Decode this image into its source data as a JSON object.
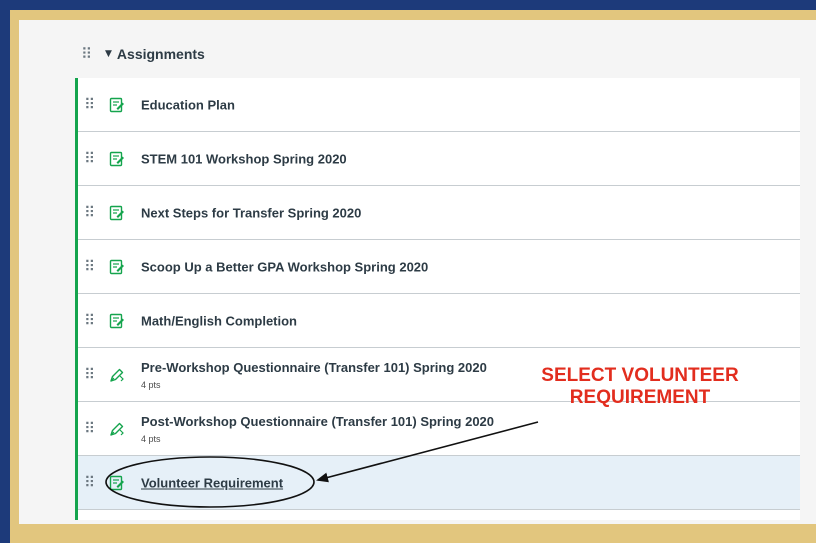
{
  "group": {
    "title": "Assignments",
    "handle_glyph": "⠿",
    "caret_glyph": "▼"
  },
  "items": [
    {
      "title": "Education Plan",
      "icon": "assignment-icon",
      "pts": ""
    },
    {
      "title": "STEM 101 Workshop Spring 2020",
      "icon": "assignment-icon",
      "pts": ""
    },
    {
      "title": "Next Steps for Transfer Spring 2020",
      "icon": "assignment-icon",
      "pts": ""
    },
    {
      "title": "Scoop Up a Better GPA Workshop Spring 2020",
      "icon": "assignment-icon",
      "pts": ""
    },
    {
      "title": "Math/English Completion",
      "icon": "assignment-icon",
      "pts": ""
    },
    {
      "title": "Pre-Workshop Questionnaire (Transfer 101) Spring 2020",
      "icon": "quiz-icon",
      "pts": "4 pts"
    },
    {
      "title": "Post-Workshop Questionnaire (Transfer 101) Spring 2020",
      "icon": "quiz-icon",
      "pts": "4 pts"
    },
    {
      "title": "Volunteer Requirement",
      "icon": "assignment-icon",
      "pts": ""
    }
  ],
  "callout": {
    "line1": "SELECT VOLUNTEER",
    "line2": "REQUIREMENT"
  },
  "colors": {
    "frame_blue": "#1d3a7a",
    "frame_gold": "#e2c67e",
    "published_green": "#14a44d",
    "annotation_red": "#e22d1e",
    "selected_row": "#e6f0f8"
  }
}
